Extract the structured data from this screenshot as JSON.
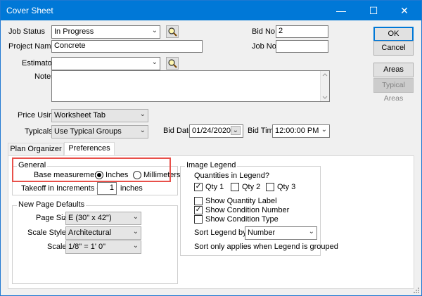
{
  "window": {
    "title": "Cover Sheet",
    "minimize": "—",
    "maximize": "☐",
    "close": "✕"
  },
  "job_status": {
    "label": "Job Status",
    "value": "In Progress"
  },
  "project_name": {
    "label": "Project Name",
    "value": "Concrete"
  },
  "estimator": {
    "label": "Estimator",
    "value": ""
  },
  "notes": {
    "label": "Notes",
    "value": ""
  },
  "bid_no": {
    "label": "Bid No.",
    "value": "2"
  },
  "job_no": {
    "label": "Job No.",
    "value": ""
  },
  "buttons": {
    "ok": "OK",
    "cancel": "Cancel",
    "areas": "Areas",
    "typical_areas": "Typical Areas"
  },
  "price_using": {
    "label": "Price Using",
    "value": "Worksheet Tab"
  },
  "typicals": {
    "label": "Typicals",
    "value": "Use Typical Groups"
  },
  "bid_date": {
    "label": "Bid Date",
    "value": "01/24/2020"
  },
  "bid_time": {
    "label": "Bid Time",
    "value": "12:00:00 PM"
  },
  "tabs": [
    {
      "label": "Plan Organizer"
    },
    {
      "label": "Preferences"
    }
  ],
  "general": {
    "title": "General",
    "base_measurement_label": "Base measurement:",
    "inches": "Inches",
    "millimeters": "Millimeters",
    "selected": "Inches",
    "takeoff_label": "Takeoff in Increments of",
    "takeoff_value": "1",
    "takeoff_unit": "inches"
  },
  "page_defaults": {
    "title": "New Page Defaults",
    "page_size_label": "Page Size",
    "page_size": "E (30\" x 42\")",
    "scale_style_label": "Scale Style",
    "scale_style": "Architectural",
    "scale_label": "Scale",
    "scale": "1/8\" = 1' 0\""
  },
  "image_legend": {
    "title": "Image Legend",
    "quantities_label": "Quantities in Legend?",
    "qty1": {
      "label": "Qty 1",
      "checked": true
    },
    "qty2": {
      "label": "Qty 2",
      "checked": false
    },
    "qty3": {
      "label": "Qty 3",
      "checked": false
    },
    "show_quantity_label": {
      "label": "Show Quantity Label",
      "checked": false
    },
    "show_condition_number": {
      "label": "Show Condition Number",
      "checked": true
    },
    "show_condition_type": {
      "label": "Show Condition Type",
      "checked": false
    },
    "sort_label": "Sort Legend by:",
    "sort_value": "Number",
    "note": "Sort only applies when Legend is grouped"
  },
  "colors": {
    "titlebar": "#0078d7",
    "highlight": "#e8504a"
  }
}
